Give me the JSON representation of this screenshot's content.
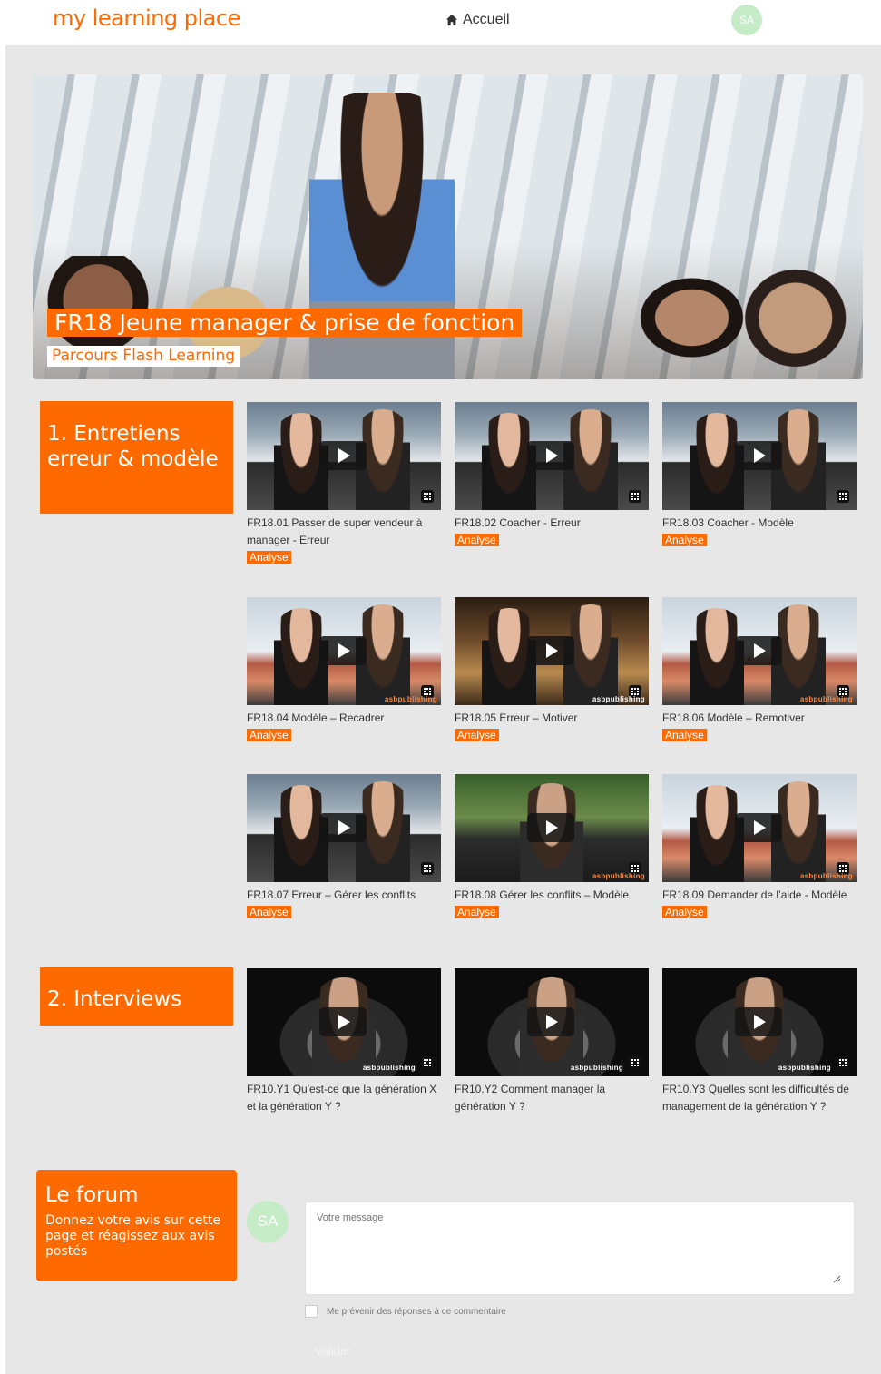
{
  "header": {
    "logo": "my learning place",
    "nav_home": "Accueil",
    "avatar_initials": "SA"
  },
  "hero": {
    "title": "FR18 Jeune manager & prise de fonction",
    "subtitle": "Parcours Flash Learning"
  },
  "sections": [
    {
      "title": "1. Entretiens erreur & modèle",
      "videos": [
        {
          "title": "FR18.01 Passer de super vendeur à manager - Erreur",
          "badge": "Analyse"
        },
        {
          "title": "FR18.02 Coacher - Erreur",
          "badge": "Analyse"
        },
        {
          "title": "FR18.03 Coacher - Modèle",
          "badge": "Analyse"
        },
        {
          "title": "FR18.04 Modèle – Recadrer",
          "badge": "Analyse"
        },
        {
          "title": "FR18.05 Erreur – Motiver",
          "badge": "Analyse"
        },
        {
          "title": "FR18.06 Modèle – Remotiver",
          "badge": "Analyse"
        },
        {
          "title": "FR18.07 Erreur – Gérer les conflits",
          "badge": "Analyse"
        },
        {
          "title": "FR18.08 Gérer les conflits – Modèle",
          "badge": "Analyse"
        },
        {
          "title": "FR18.09 Demander de l’aide - Modèle",
          "badge": "Analyse"
        }
      ]
    },
    {
      "title": "2. Interviews",
      "videos": [
        {
          "title": "FR10.Y1 Qu'est-ce que la génération X et la génération Y ?"
        },
        {
          "title": "FR10.Y2 Comment manager la génération Y ?"
        },
        {
          "title": "FR10.Y3 Quelles sont les difficultés de management de la génération Y ?"
        }
      ]
    }
  ],
  "thumb_brand": "asbpublishing",
  "forum": {
    "title": "Le forum",
    "description": "Donnez votre avis sur cette page et réagissez aux avis postés",
    "avatar_initials": "SA",
    "message_placeholder": "Votre message",
    "notify_label": "Me prévenir des réponses à ce commentaire",
    "submit_label": "Valider"
  },
  "colors": {
    "accent": "#ff6a00",
    "background": "#e7e7e7",
    "avatar": "#c5ecc6"
  }
}
